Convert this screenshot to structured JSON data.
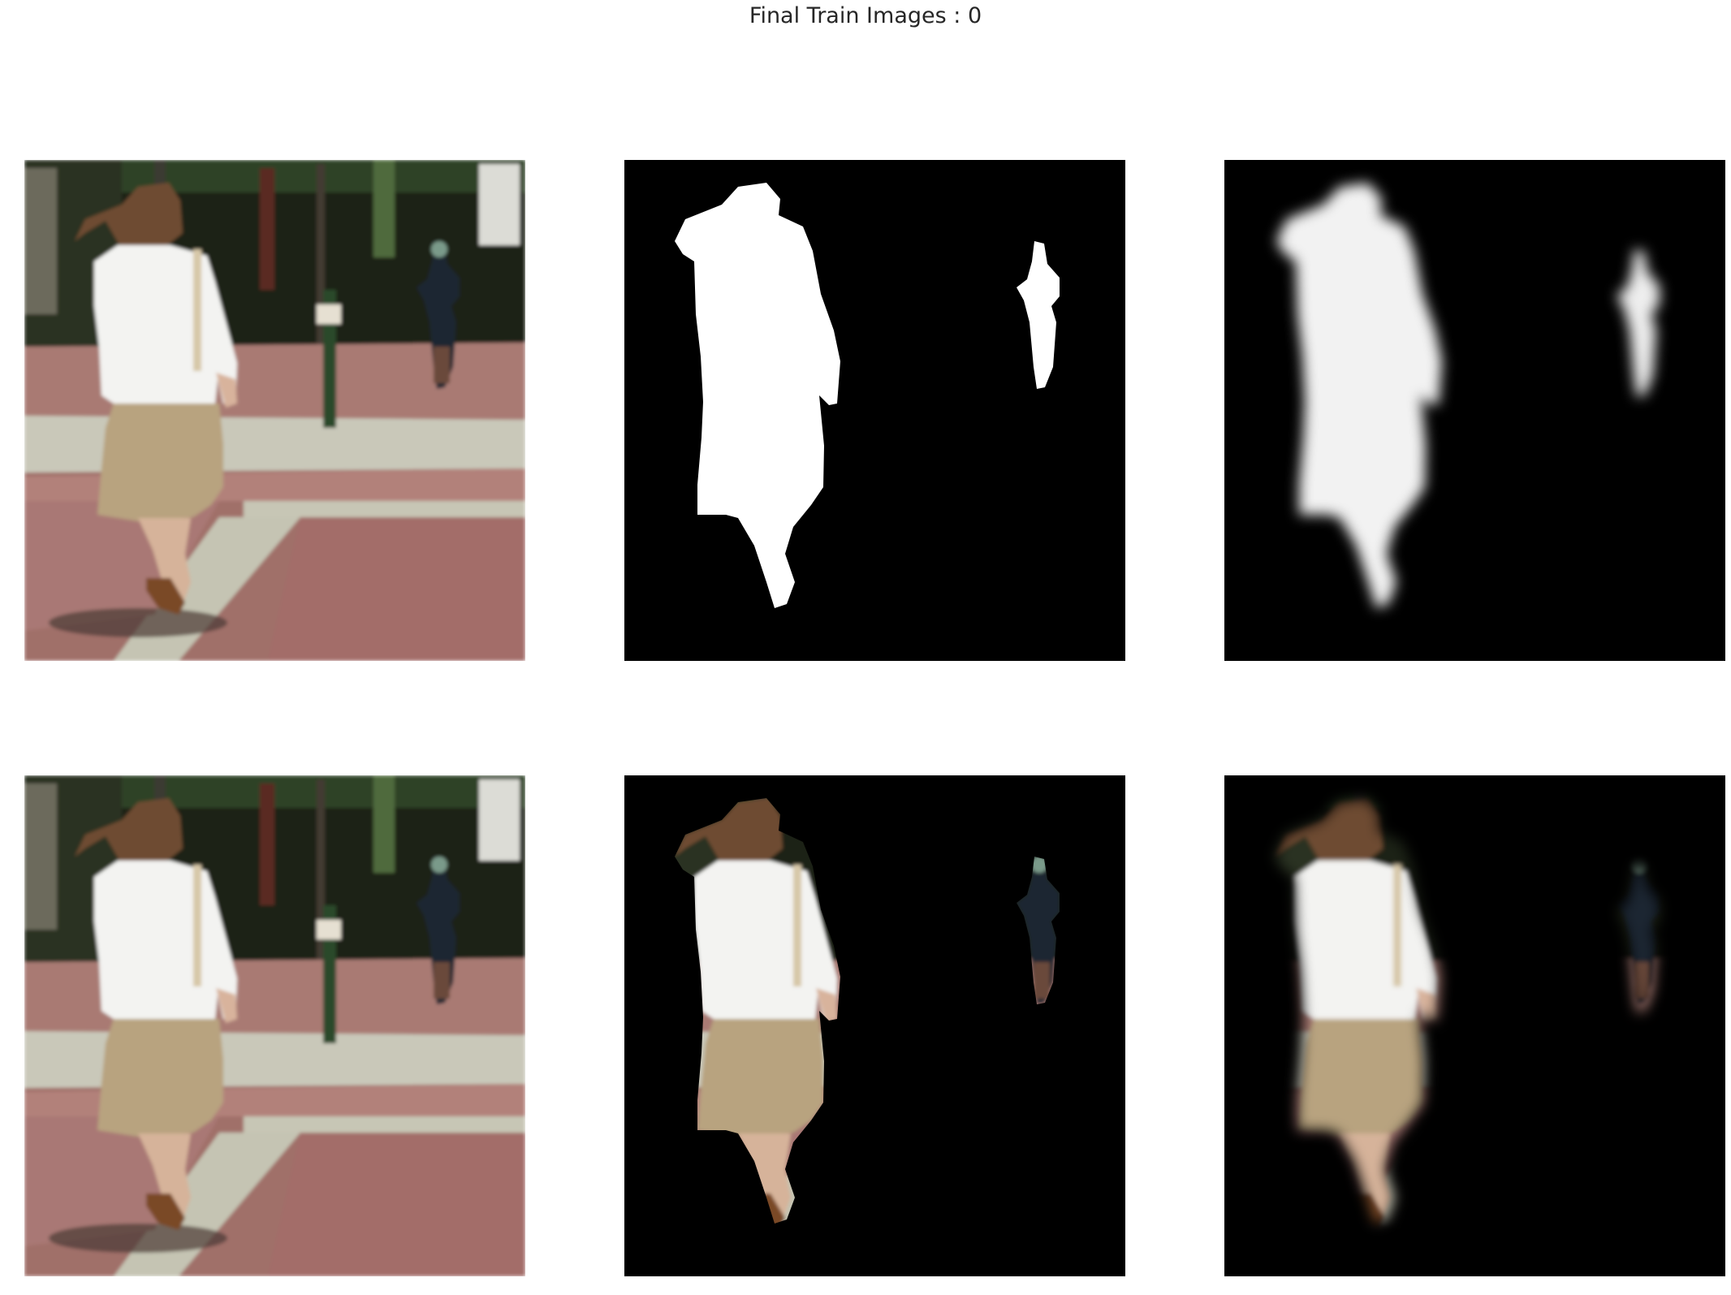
{
  "figure": {
    "title": "Final Train Images : 0"
  },
  "panels": [
    {
      "row": 1,
      "col": 1,
      "content": "photo",
      "icon": "input-photo-icon"
    },
    {
      "row": 1,
      "col": 2,
      "content": "ground-truth-mask",
      "icon": "mask-icon"
    },
    {
      "row": 1,
      "col": 3,
      "content": "predicted-mask",
      "icon": "soft-mask-icon"
    },
    {
      "row": 2,
      "col": 1,
      "content": "photo",
      "icon": "input-photo-icon"
    },
    {
      "row": 2,
      "col": 2,
      "content": "photo-masked-by-ground-truth",
      "icon": "cutout-icon"
    },
    {
      "row": 2,
      "col": 3,
      "content": "photo-masked-by-prediction",
      "icon": "soft-cutout-icon"
    }
  ],
  "colors": {
    "background": "#ffffff",
    "mask_background": "#000000",
    "mask_foreground": "#ffffff",
    "pavement_brick": "#9a6a66",
    "pavement_concrete": "#c7c6b6",
    "trees": "#1b2414",
    "skirt": "#b7a27f",
    "shirt": "#f4f4f2",
    "hair": "#6b4a30"
  }
}
